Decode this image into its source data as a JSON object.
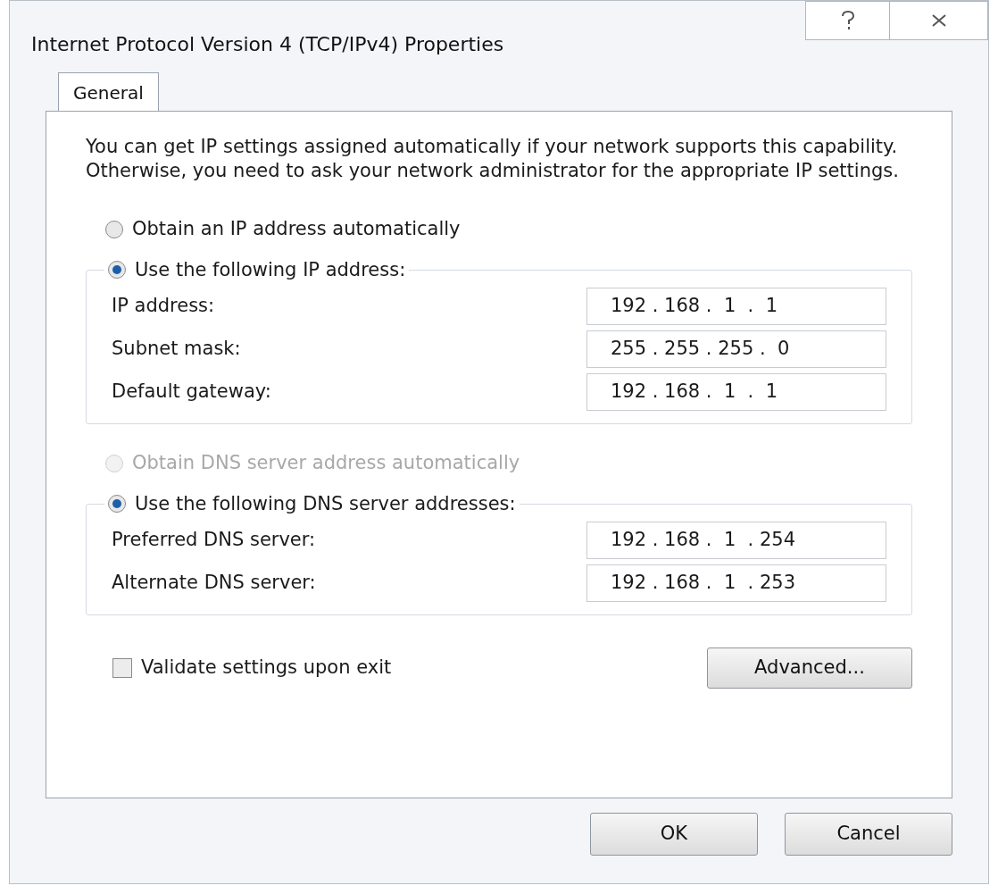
{
  "window": {
    "title": "Internet Protocol Version 4 (TCP/IPv4) Properties"
  },
  "tabs": [
    {
      "label": "General",
      "selected": true
    }
  ],
  "intro": "You can get IP settings assigned automatically if your network supports this capability. Otherwise, you need to ask your network administrator for the appropriate IP settings.",
  "ip_section": {
    "options": [
      {
        "label": "Obtain an IP address automatically",
        "selected": false,
        "disabled": false
      },
      {
        "label": "Use the following IP address:",
        "selected": true,
        "disabled": false
      }
    ],
    "fields": [
      {
        "label": "IP address:",
        "value": "192 . 168 .  1  .  1"
      },
      {
        "label": "Subnet mask:",
        "value": "255 . 255 . 255 .  0"
      },
      {
        "label": "Default gateway:",
        "value": "192 . 168 .  1  .  1"
      }
    ]
  },
  "dns_section": {
    "options": [
      {
        "label": "Obtain DNS server address automatically",
        "selected": false,
        "disabled": true
      },
      {
        "label": "Use the following DNS server addresses:",
        "selected": true,
        "disabled": false
      }
    ],
    "fields": [
      {
        "label": "Preferred DNS server:",
        "value": "192 . 168 .  1  . 254"
      },
      {
        "label": "Alternate DNS server:",
        "value": "192 . 168 .  1  . 253"
      }
    ]
  },
  "validate": {
    "label": "Validate settings upon exit",
    "checked": false
  },
  "advanced_button": "Advanced...",
  "footer_buttons": [
    "OK",
    "Cancel"
  ]
}
